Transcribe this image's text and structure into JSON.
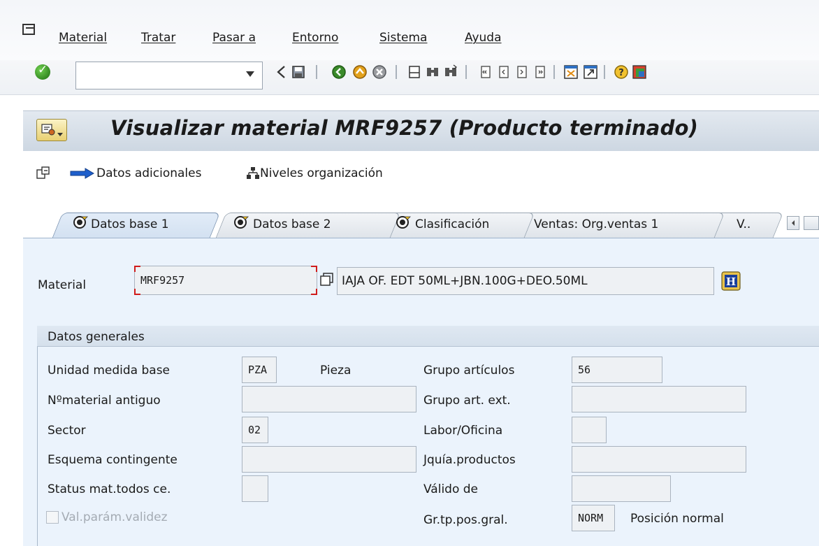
{
  "menu": {
    "items": [
      "Material",
      "Tratar",
      "Pasar a",
      "Entorno",
      "Sistema",
      "Ayuda"
    ]
  },
  "toolbar": {
    "command_field_value": "",
    "icons": [
      "enter-icon",
      "back-icon",
      "save-icon",
      "exit-icon",
      "cancel-icon",
      "print-icon",
      "find-icon",
      "find-next-icon",
      "first-page-icon",
      "previous-page-icon",
      "next-page-icon",
      "last-page-icon",
      "create-session-icon",
      "shortcut-icon",
      "help-icon",
      "customize-layout-icon"
    ]
  },
  "title": {
    "text": "Visualizar material MRF9257 (Producto terminado)"
  },
  "app_toolbar": {
    "additional_data_label": "Datos adicionales",
    "org_levels_label": "Niveles organización"
  },
  "tabs": [
    {
      "label": "Datos base 1",
      "active": true
    },
    {
      "label": "Datos base 2",
      "active": false
    },
    {
      "label": "Clasificación",
      "active": false
    },
    {
      "label": "Ventas: Org.ventas 1",
      "active": false
    },
    {
      "label": "V..",
      "active": false
    }
  ],
  "header": {
    "material_label": "Material",
    "material_value": "MRF9257",
    "description_value": "IAJA OF. EDT 50ML+JBN.100G+DEO.50ML"
  },
  "general_data": {
    "title": "Datos generales",
    "base_uom_label": "Unidad medida base",
    "base_uom_value": "PZA",
    "base_uom_text": "Pieza",
    "old_material_label": "Nºmaterial antiguo",
    "old_material_value": "",
    "division_label": "Sector",
    "division_value": "02",
    "allocation_label": "Esquema contingente",
    "allocation_value": "",
    "xplant_status_label": "Status mat.todos ce.",
    "xplant_status_value": "",
    "valid_params_label": "Val.parám.validez",
    "material_group_label": "Grupo artículos",
    "material_group_value": "56",
    "ext_group_label": "Grupo art. ext.",
    "ext_group_value": "",
    "lab_office_label": "Labor/Oficina",
    "lab_office_value": "",
    "hierarchy_label": "Jquía.productos",
    "hierarchy_value": "",
    "valid_from_label": "Válido de",
    "valid_from_value": "",
    "item_cat_label": "Gr.tp.pos.gral.",
    "item_cat_value": "NORM",
    "item_cat_text": "Posición normal"
  },
  "colors": {
    "panel_bg": "#ebf3fc",
    "title_bg": "#d5dfe9",
    "field_bg": "#eef1f4",
    "required_marker": "#d01c1c"
  }
}
